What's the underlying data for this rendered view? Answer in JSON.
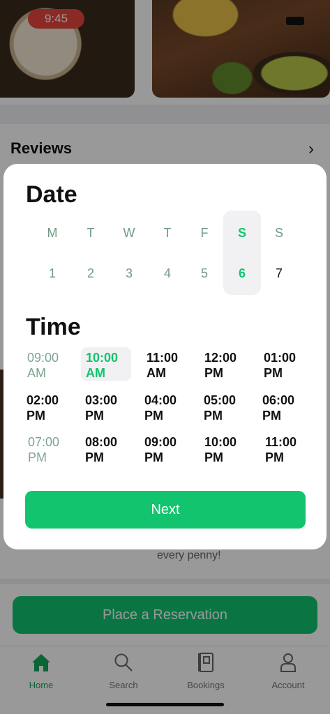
{
  "status_bar": {
    "time": "9:45"
  },
  "background": {
    "reviews_title": "Reviews",
    "review_snippet": "every penny!",
    "reserve_button": "Place a Reservation"
  },
  "tabbar": {
    "items": [
      {
        "label": "Home",
        "icon": "home-icon",
        "active": true
      },
      {
        "label": "Search",
        "icon": "search-icon",
        "active": false
      },
      {
        "label": "Bookings",
        "icon": "bookings-icon",
        "active": false
      },
      {
        "label": "Account",
        "icon": "account-icon",
        "active": false
      }
    ]
  },
  "modal": {
    "date_title": "Date",
    "time_title": "Time",
    "weekdays": [
      "M",
      "T",
      "W",
      "T",
      "F",
      "S",
      "S"
    ],
    "days": [
      "1",
      "2",
      "3",
      "4",
      "5",
      "6",
      "7"
    ],
    "selected_day_index": 5,
    "time_slots": [
      {
        "time": "09:00",
        "period": "AM",
        "state": "past"
      },
      {
        "time": "10:00",
        "period": "AM",
        "state": "selected"
      },
      {
        "time": "11:00",
        "period": "AM",
        "state": "available"
      },
      {
        "time": "12:00",
        "period": "PM",
        "state": "available"
      },
      {
        "time": "01:00",
        "period": "PM",
        "state": "available"
      },
      {
        "time": "02:00",
        "period": "PM",
        "state": "available"
      },
      {
        "time": "03:00",
        "period": "PM",
        "state": "available"
      },
      {
        "time": "04:00",
        "period": "PM",
        "state": "available"
      },
      {
        "time": "05:00",
        "period": "PM",
        "state": "available"
      },
      {
        "time": "06:00",
        "period": "PM",
        "state": "available"
      },
      {
        "time": "07:00",
        "period": "PM",
        "state": "past"
      },
      {
        "time": "08:00",
        "period": "PM",
        "state": "available"
      },
      {
        "time": "09:00",
        "period": "PM",
        "state": "available"
      },
      {
        "time": "10:00",
        "period": "PM",
        "state": "available"
      },
      {
        "time": "11:00",
        "period": "PM",
        "state": "available"
      }
    ],
    "next_button": "Next"
  },
  "colors": {
    "accent": "#12c46e",
    "muted_green": "#6f9a83",
    "status_pill": "#e8453c"
  }
}
